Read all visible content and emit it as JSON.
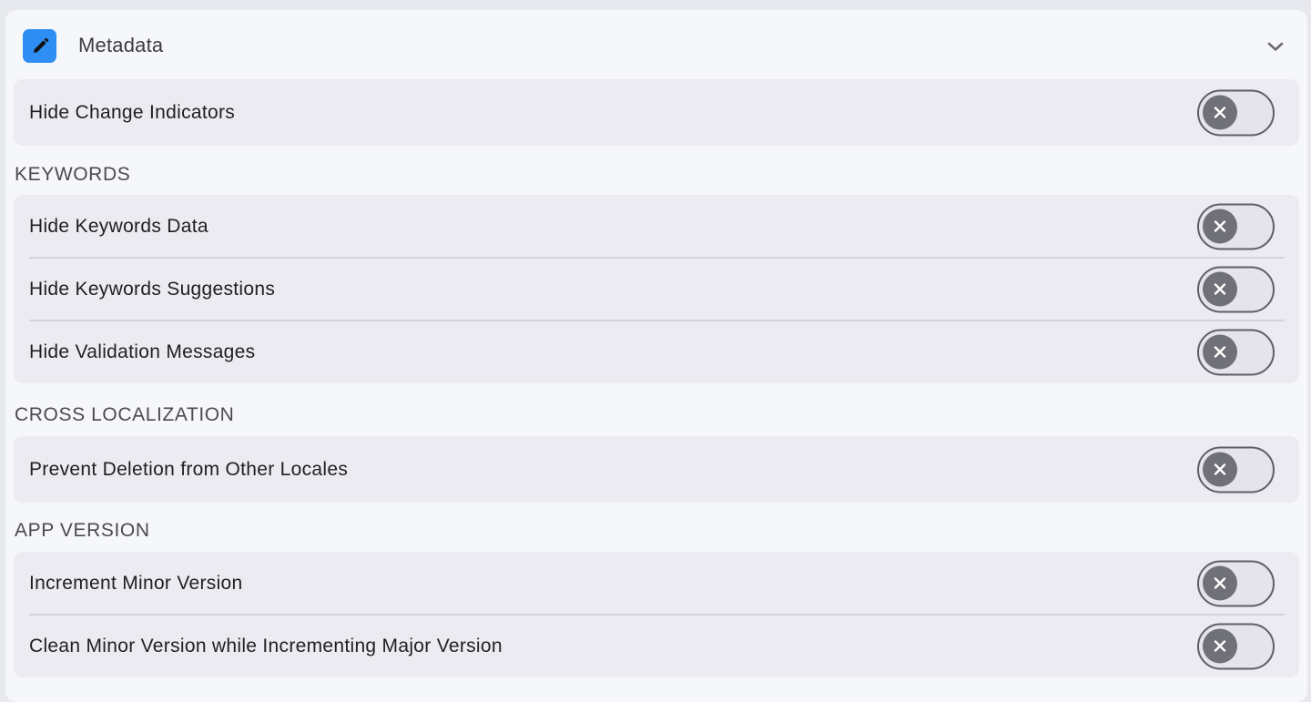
{
  "header": {
    "title": "Metadata",
    "icon": "pencil-icon",
    "icon_bg": "#2f8ef3",
    "collapse_icon": "chevron-down-icon"
  },
  "top_card": {
    "rows": [
      {
        "label": "Hide Change Indicators",
        "enabled": false
      }
    ]
  },
  "sections": [
    {
      "title": "KEYWORDS",
      "rows": [
        {
          "label": "Hide Keywords Data",
          "enabled": false
        },
        {
          "label": "Hide Keywords Suggestions",
          "enabled": false
        },
        {
          "label": "Hide Validation Messages",
          "enabled": false
        }
      ]
    },
    {
      "title": "CROSS LOCALIZATION",
      "rows": [
        {
          "label": "Prevent Deletion from Other Locales",
          "enabled": false
        }
      ]
    },
    {
      "title": "APP VERSION",
      "rows": [
        {
          "label": "Increment Minor Version",
          "enabled": false
        },
        {
          "label": "Clean Minor Version while Incrementing Major Version",
          "enabled": false
        }
      ]
    }
  ],
  "colors": {
    "panel_bg": "#f6f7fb",
    "card_bg": "#ebebf1",
    "toggle_off_knob": "#6f7078"
  }
}
